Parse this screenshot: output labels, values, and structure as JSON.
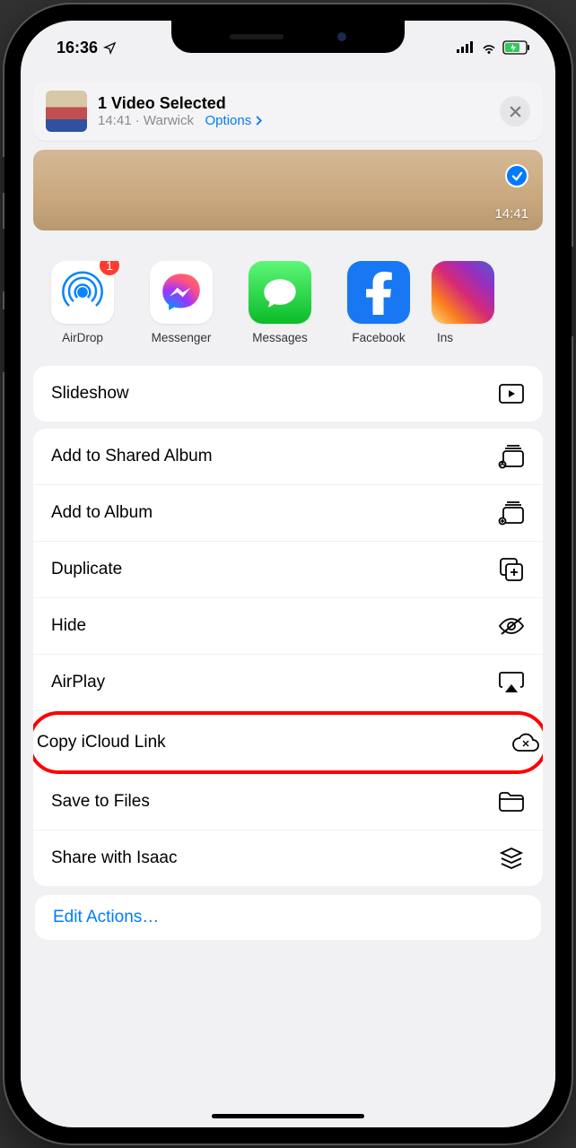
{
  "status": {
    "time": "16:36"
  },
  "header": {
    "title": "1 Video Selected",
    "time": "14:41",
    "location": "Warwick",
    "options_label": "Options"
  },
  "preview": {
    "duration": "14:41"
  },
  "apps": [
    {
      "label": "AirDrop",
      "badge": "1"
    },
    {
      "label": "Messenger"
    },
    {
      "label": "Messages"
    },
    {
      "label": "Facebook"
    },
    {
      "label": "Ins"
    }
  ],
  "actions_top": [
    {
      "label": "Slideshow"
    }
  ],
  "actions": [
    {
      "label": "Add to Shared Album"
    },
    {
      "label": "Add to Album"
    },
    {
      "label": "Duplicate"
    },
    {
      "label": "Hide"
    },
    {
      "label": "AirPlay"
    },
    {
      "label": "Copy iCloud Link"
    },
    {
      "label": "Save to Files"
    },
    {
      "label": "Share with Isaac"
    }
  ],
  "edit_actions": "Edit Actions…"
}
